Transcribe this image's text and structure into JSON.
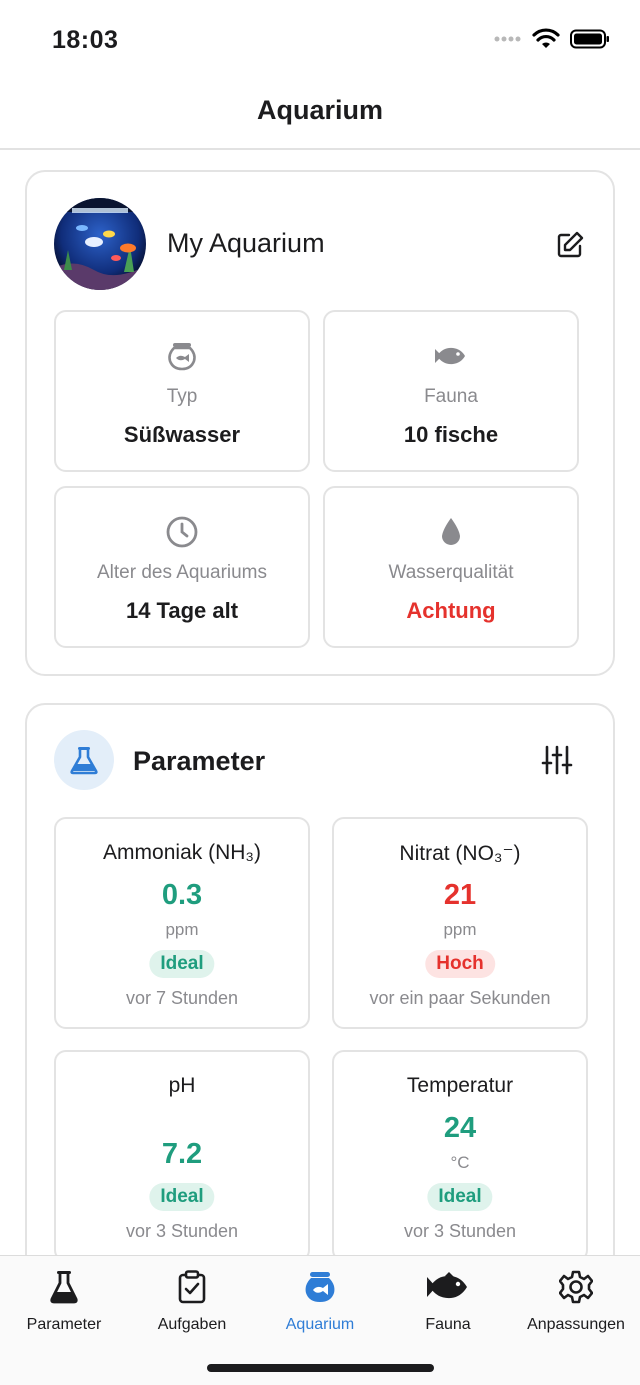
{
  "status": {
    "time": "18:03"
  },
  "nav": {
    "title": "Aquarium"
  },
  "aquarium": {
    "name": "My Aquarium",
    "tiles": [
      {
        "icon": "fishbowl-icon",
        "label": "Typ",
        "value": "Süßwasser"
      },
      {
        "icon": "fish-icon",
        "label": "Fauna",
        "value": "10 fische"
      },
      {
        "icon": "clock-icon",
        "label": "Alter des Aquariums",
        "value": "14 Tage alt"
      },
      {
        "icon": "water-drop-icon",
        "label": "Wasserqualität",
        "value": "Achtung",
        "value_color": "#e5322d"
      }
    ]
  },
  "parameters": {
    "title": "Parameter",
    "items": [
      {
        "name": "Ammoniak (NH₃)",
        "value": "0.3",
        "unit": "ppm",
        "status": "Ideal",
        "time": "vor 7 Stunden"
      },
      {
        "name": "Nitrat (NO₃⁻)",
        "value": "21",
        "unit": "ppm",
        "status": "Hoch",
        "time": "vor ein paar Sekunden"
      },
      {
        "name": "pH",
        "value": "7.2",
        "unit": "",
        "status": "Ideal",
        "time": "vor 3 Stunden"
      },
      {
        "name": "Temperatur",
        "value": "24",
        "unit": "°C",
        "status": "Ideal",
        "time": "vor 3 Stunden"
      }
    ]
  },
  "tabs": [
    {
      "label": "Parameter",
      "icon": "flask-icon"
    },
    {
      "label": "Aufgaben",
      "icon": "clipboard-check-icon"
    },
    {
      "label": "Aquarium",
      "icon": "fishbowl-icon",
      "active": true
    },
    {
      "label": "Fauna",
      "icon": "fish-icon"
    },
    {
      "label": "Anpassungen",
      "icon": "gear-icon"
    }
  ],
  "colors": {
    "accent": "#2f7dd6",
    "ideal": "#1f9d7e",
    "alert": "#e5322d"
  }
}
